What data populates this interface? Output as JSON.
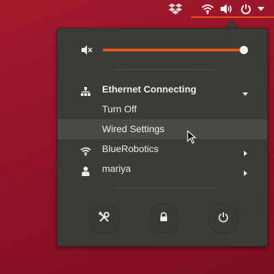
{
  "topbar": {
    "icons": [
      "dropbox-icon",
      "network-wireless-icon",
      "volume-icon",
      "power-icon",
      "dropdown-arrow-icon"
    ],
    "accent": "#e95420"
  },
  "system_menu": {
    "volume": {
      "icon": "volume-muted-icon",
      "level": 0.99
    },
    "ethernet": {
      "label": "Ethernet Connecting",
      "icon": "network-wired-icon",
      "expanded": true,
      "submenu": [
        {
          "label": "Turn Off"
        },
        {
          "label": "Wired Settings",
          "highlighted": true
        }
      ]
    },
    "wifi": {
      "label": "BlueRobotics",
      "icon": "wifi-icon"
    },
    "user": {
      "label": "mariya",
      "icon": "user-icon"
    },
    "bottom_buttons": [
      "settings-icon",
      "lock-icon",
      "power-icon"
    ]
  },
  "colors": {
    "desktop": "#8f1226",
    "menu_bg": "#3d3b37",
    "highlight": "#4b4a46",
    "text": "#eeeeec"
  }
}
